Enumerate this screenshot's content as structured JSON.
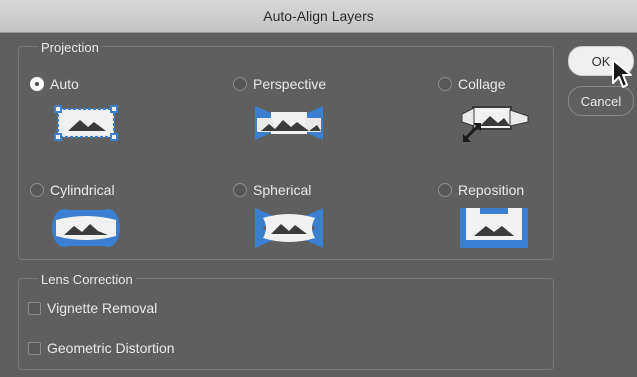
{
  "window": {
    "title": "Auto-Align Layers"
  },
  "projection": {
    "label": "Projection",
    "options": [
      {
        "label": "Auto",
        "selected": true,
        "icon": "auto-projection-icon"
      },
      {
        "label": "Perspective",
        "selected": false,
        "icon": "perspective-projection-icon"
      },
      {
        "label": "Collage",
        "selected": false,
        "icon": "collage-projection-icon"
      },
      {
        "label": "Cylindrical",
        "selected": false,
        "icon": "cylindrical-projection-icon"
      },
      {
        "label": "Spherical",
        "selected": false,
        "icon": "spherical-projection-icon"
      },
      {
        "label": "Reposition",
        "selected": false,
        "icon": "reposition-projection-icon"
      }
    ]
  },
  "lens": {
    "label": "Lens Correction",
    "options": [
      {
        "label": "Vignette Removal",
        "checked": false
      },
      {
        "label": "Geometric Distortion",
        "checked": false
      }
    ]
  },
  "buttons": {
    "ok": "OK",
    "cancel": "Cancel"
  },
  "colors": {
    "accent": "#3a7fd0",
    "panel": "#5f5f5f",
    "titlebar": "#cfcfcf"
  }
}
